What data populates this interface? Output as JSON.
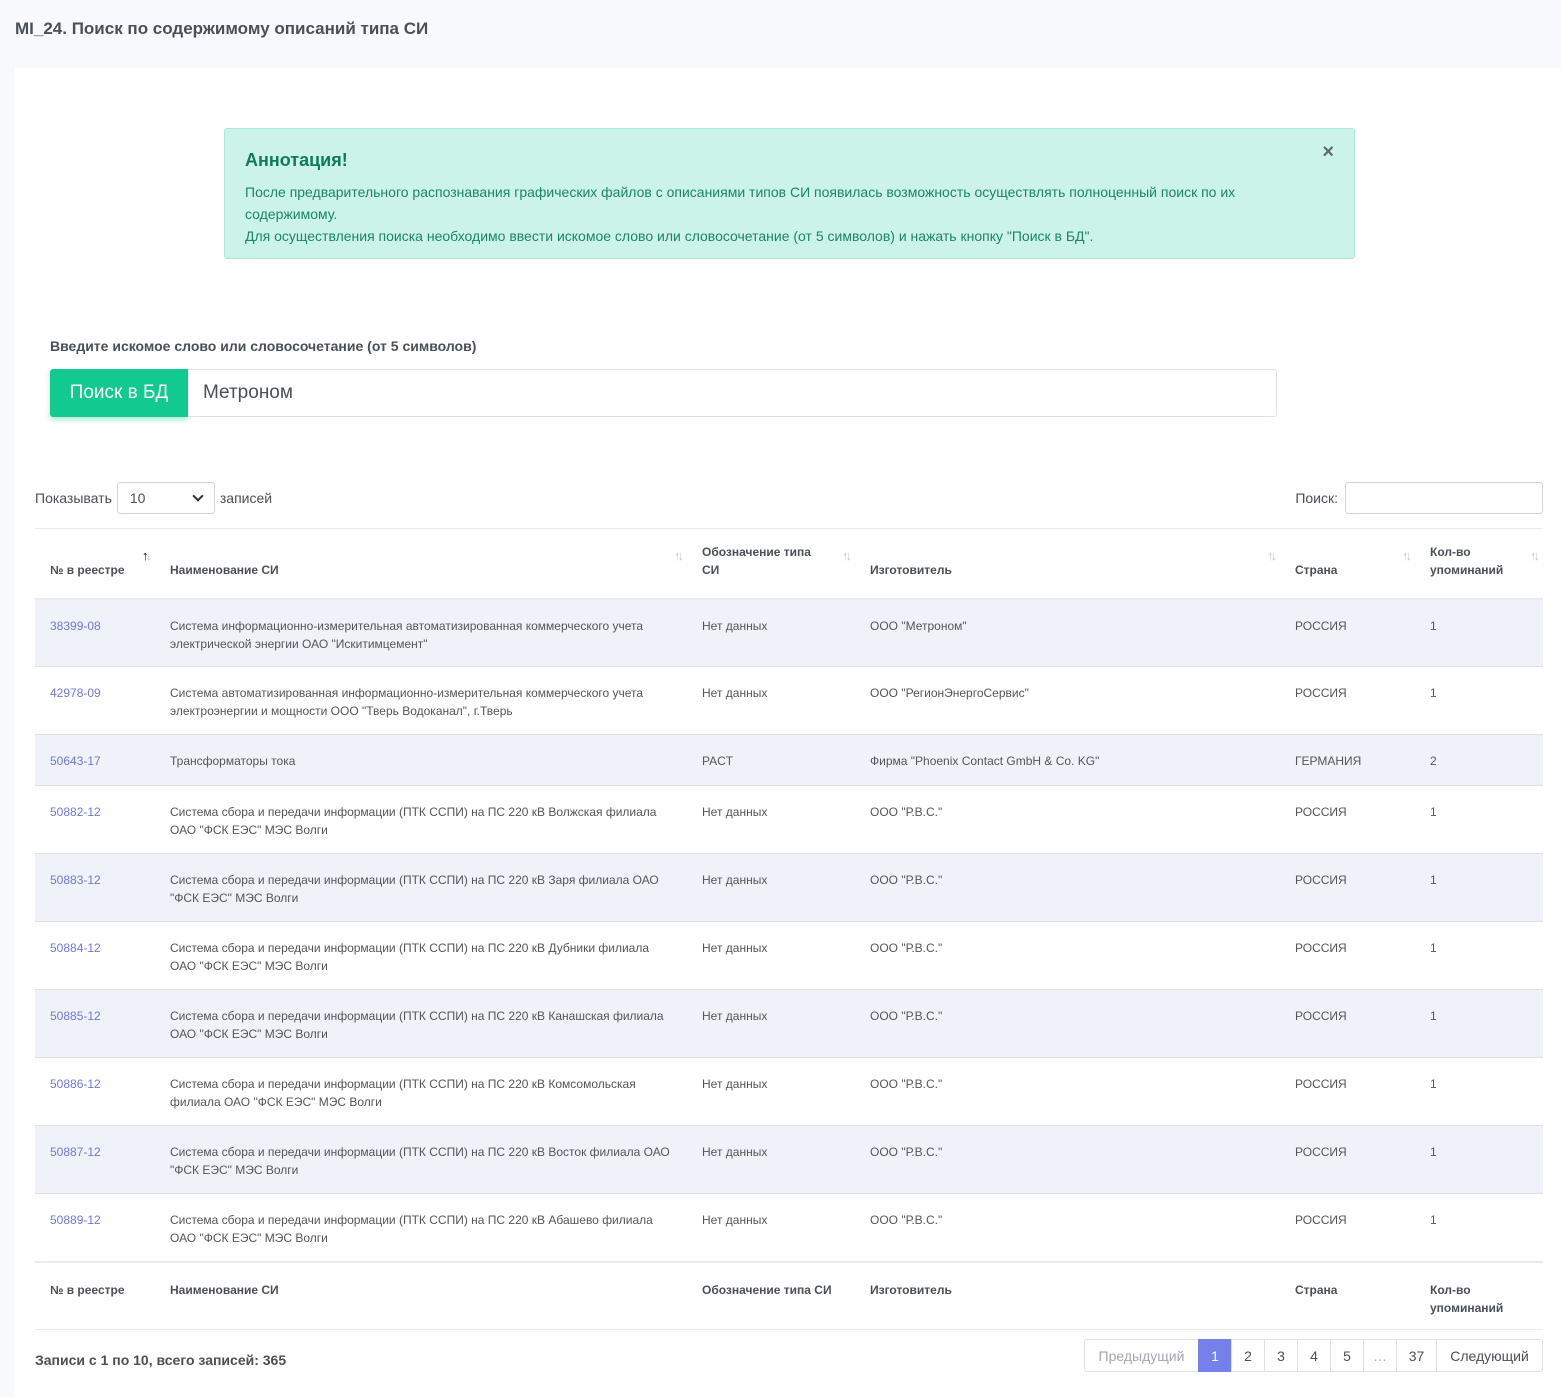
{
  "page": {
    "title": "MI_24. Поиск по содержимому описаний типа СИ"
  },
  "alert": {
    "title": "Аннотация!",
    "line1": "После предварительного распознавания графических файлов с описаниями типов СИ появилась возможность осуществлять полноценный поиск по их содержимому.",
    "line2": "Для осуществления поиска необходимо ввести искомое слово или словосочетание (от 5 символов) и нажать кнопку \"Поиск в БД\".",
    "close": "×"
  },
  "search": {
    "label": "Введите искомое слово или словосочетание (от 5 символов)",
    "button": "Поиск в БД",
    "value": "Метроном"
  },
  "table_controls": {
    "show_label": "Показывать",
    "length_value": "10",
    "records_label": "записей",
    "filter_label": "Поиск:"
  },
  "columns": [
    "№ в реестре",
    "Наименование СИ",
    "Обозначение типа СИ",
    "Изготовитель",
    "Страна",
    "Кол-во упоминаний"
  ],
  "header_lines": {
    "type1": "Обозначение типа",
    "type2": "СИ",
    "count1": "Кол-во",
    "count2": "упоминаний"
  },
  "rows": [
    [
      "38399-08",
      "Система информационно-измерительная автоматизированная коммерческого учета электрической энергии ОАО \"Искитимцемент\"",
      "Нет данных",
      "ООО \"Метроном\"",
      "РОССИЯ",
      "1"
    ],
    [
      "42978-09",
      "Система автоматизированная информационно-измерительная коммерческого учета электроэнергии и мощности ООО \"Тверь Водоканал\", г.Тверь",
      "Нет данных",
      "ООО \"РегионЭнергоСервис\"",
      "РОССИЯ",
      "1"
    ],
    [
      "50643-17",
      "Трансформаторы тока",
      "PACT",
      "Фирма \"Phoenix Contact GmbH & Co. KG\"",
      "ГЕРМАНИЯ",
      "2"
    ],
    [
      "50882-12",
      "Система сбора и передачи информации (ПТК ССПИ) на ПС 220 кВ Волжская филиала ОАО \"ФСК ЕЭС\" МЭС Волги",
      "Нет данных",
      "ООО \"Р.В.С.\"",
      "РОССИЯ",
      "1"
    ],
    [
      "50883-12",
      "Система сбора и передачи информации (ПТК ССПИ) на ПС 220 кВ Заря филиала ОАО \"ФСК ЕЭС\" МЭС Волги",
      "Нет данных",
      "ООО \"Р.В.С.\"",
      "РОССИЯ",
      "1"
    ],
    [
      "50884-12",
      "Система сбора и передачи информации (ПТК ССПИ) на ПС 220 кВ Дубники филиала ОАО \"ФСК ЕЭС\" МЭС Волги",
      "Нет данных",
      "ООО \"Р.В.С.\"",
      "РОССИЯ",
      "1"
    ],
    [
      "50885-12",
      "Система сбора и передачи информации (ПТК ССПИ) на ПС 220 кВ Канашская филиала ОАО \"ФСК ЕЭС\" МЭС Волги",
      "Нет данных",
      "ООО \"Р.В.С.\"",
      "РОССИЯ",
      "1"
    ],
    [
      "50886-12",
      "Система сбора и передачи информации (ПТК ССПИ) на ПС 220 кВ Комсомольская филиала ОАО \"ФСК ЕЭС\" МЭС Волги",
      "Нет данных",
      "ООО \"Р.В.С.\"",
      "РОССИЯ",
      "1"
    ],
    [
      "50887-12",
      "Система сбора и передачи информации (ПТК ССПИ) на ПС 220 кВ Восток филиала ОАО \"ФСК ЕЭС\" МЭС Волги",
      "Нет данных",
      "ООО \"Р.В.С.\"",
      "РОССИЯ",
      "1"
    ],
    [
      "50889-12",
      "Система сбора и передачи информации (ПТК ССПИ) на ПС 220 кВ Абашево филиала ОАО \"ФСК ЕЭС\" МЭС Волги",
      "Нет данных",
      "ООО \"Р.В.С.\"",
      "РОССИЯ",
      "1"
    ]
  ],
  "footer": {
    "info": "Записи с 1 по 10, всего записей: 365"
  },
  "pagination": {
    "prev": "Предыдущий",
    "pages": [
      "1",
      "2",
      "3",
      "4",
      "5"
    ],
    "ellipsis": "…",
    "last": "37",
    "next": "Следующий",
    "active": "1"
  },
  "colors": {
    "accent": "#12c98f",
    "link": "#6f78d9",
    "active_page": "#7680ea",
    "alert_bg": "#ccf3e8"
  }
}
